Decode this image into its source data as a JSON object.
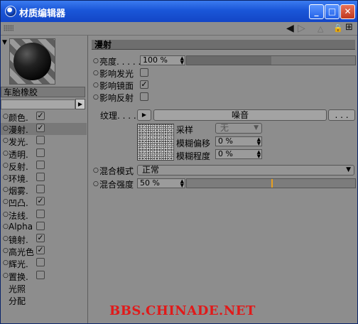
{
  "window": {
    "title": "材质编辑器",
    "minimize": "_",
    "maximize": "□",
    "close": "✕"
  },
  "toolbar": {
    "back": "◀",
    "forward": "▷",
    "lock": "🔒",
    "new": "⊞"
  },
  "material": {
    "name": "车胎橡胶"
  },
  "channels": [
    {
      "label": "颜色.",
      "checked": true,
      "has_box": true
    },
    {
      "label": "漫射.",
      "checked": true,
      "has_box": true
    },
    {
      "label": "发光.",
      "checked": false,
      "has_box": true
    },
    {
      "label": "透明.",
      "checked": false,
      "has_box": true
    },
    {
      "label": "反射.",
      "checked": false,
      "has_box": true
    },
    {
      "label": "环境.",
      "checked": false,
      "has_box": true
    },
    {
      "label": "烟雾.",
      "checked": false,
      "has_box": true
    },
    {
      "label": "凹凸.",
      "checked": true,
      "has_box": true
    },
    {
      "label": "法线.",
      "checked": false,
      "has_box": true
    },
    {
      "label": "Alpha",
      "checked": false,
      "has_box": true
    },
    {
      "label": "镜射.",
      "checked": true,
      "has_box": true
    },
    {
      "label": "高光色",
      "checked": true,
      "has_box": true
    },
    {
      "label": "辉光.",
      "checked": false,
      "has_box": true
    },
    {
      "label": "置换.",
      "checked": false,
      "has_box": true
    },
    {
      "label": "光照",
      "checked": false,
      "has_box": false
    },
    {
      "label": "分配",
      "checked": false,
      "has_box": false
    }
  ],
  "diffuse": {
    "section_title": "漫射",
    "brightness_label": "亮度. . . . .",
    "brightness_value": "100 %",
    "brightness_level": 1.0,
    "affect_glow_label": "影响发光",
    "affect_glow": false,
    "affect_specular_label": "影响镜面",
    "affect_specular": true,
    "affect_reflection_label": "影响反射",
    "affect_reflection": false,
    "texture_label": "纹理. . . . .",
    "texture_name": "噪音",
    "texture_more": ". . .",
    "sampling_label": "采样",
    "sampling_value": "无",
    "blur_offset_label": "模糊偏移",
    "blur_offset_value": "0 %",
    "blur_scale_label": "模糊程度",
    "blur_scale_value": "0 %",
    "mix_mode_label": "混合模式",
    "mix_mode_value": "正常",
    "mix_strength_label": "混合强度",
    "mix_strength_value": "50 %",
    "mix_strength_level": 0.5
  },
  "watermark": "BBS.CHINADE.NET"
}
